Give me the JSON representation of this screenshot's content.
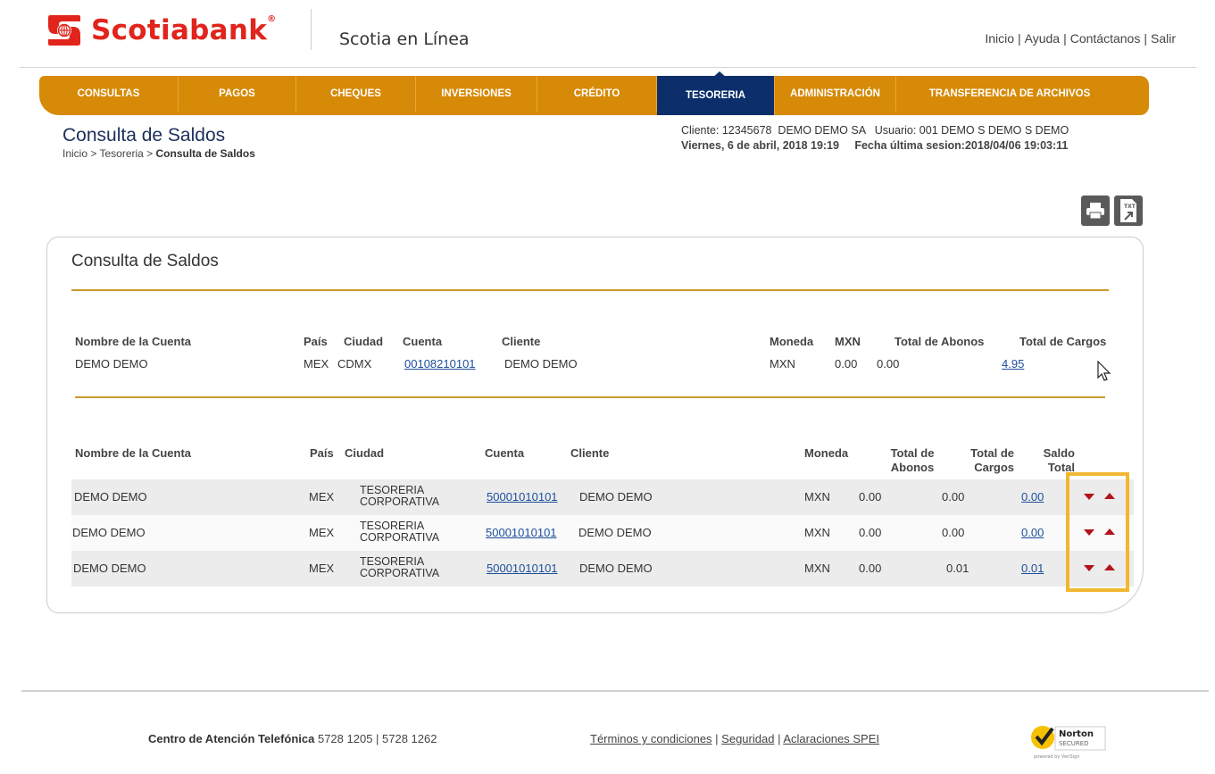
{
  "header": {
    "brand": "Scotiabank",
    "brand_reg": "®",
    "app_name": "Scotia en Línea",
    "links": [
      "Inicio",
      "Ayuda",
      "Contáctanos",
      "Salir"
    ]
  },
  "nav": {
    "items": [
      {
        "label": "CONSULTAS",
        "active": false
      },
      {
        "label": "PAGOS",
        "active": false
      },
      {
        "label": "CHEQUES",
        "active": false
      },
      {
        "label": "INVERSIONES",
        "active": false
      },
      {
        "label": "CRÉDITO",
        "active": false
      },
      {
        "label": "TESORERIA",
        "active": true
      },
      {
        "label": "ADMINISTRACIÓN",
        "active": false
      },
      {
        "label": "TRANSFERENCIA DE ARCHIVOS",
        "active": false
      }
    ]
  },
  "page": {
    "title": "Consulta de Saldos",
    "breadcrumb_prefix": "Inicio > Tesoreria > ",
    "breadcrumb_current": "Consulta de Saldos"
  },
  "client": {
    "line1": "Cliente: 12345678  DEMO DEMO SA   Usuario: 001 DEMO S DEMO S DEMO",
    "line2": "Viernes, 6 de abril, 2018 19:19     Fecha última sesion:2018/04/06 19:03:11"
  },
  "tools": {
    "print_icon": "printer-icon",
    "export_icon": "txt-export-icon",
    "export_label": "TXT"
  },
  "panel": {
    "title": "Consulta de Saldos",
    "summary_headers": {
      "name": "Nombre de la Cuenta",
      "country": "País",
      "city": "Ciudad",
      "account": "Cuenta",
      "client": "Cliente",
      "currency": "Moneda",
      "mxn": "MXN",
      "credits": "Total de Abonos",
      "debits": "Total de Cargos"
    },
    "summary_row": {
      "name": "DEMO DEMO",
      "country": "MEX",
      "city": "CDMX",
      "account": "00108210101",
      "client": "DEMO DEMO",
      "currency": "MXN",
      "mxn": "0.00",
      "credits": "0.00",
      "debits": "4.95"
    },
    "detail_headers": {
      "name": "Nombre de la Cuenta",
      "country": "País",
      "city": "Ciudad",
      "account": "Cuenta",
      "client": "Cliente",
      "currency": "Moneda",
      "credits_1": "Total de",
      "credits_2": "Abonos",
      "debits_1": "Total de",
      "debits_2": "Cargos",
      "balance_1": "Saldo",
      "balance_2": "Total"
    },
    "detail_rows": [
      {
        "name": "DEMO DEMO",
        "country": "MEX",
        "city_1": "TESORERIA",
        "city_2": "CORPORATIVA",
        "account": "50001010101",
        "client": "DEMO DEMO",
        "currency": "MXN",
        "credits": "0.00",
        "debits": "0.00",
        "balance": "0.00"
      },
      {
        "name": "DEMO DEMO",
        "country": "MEX",
        "city_1": "TESORERIA",
        "city_2": "CORPORATIVA",
        "account": "50001010101",
        "client": "DEMO DEMO",
        "currency": "MXN",
        "credits": "0.00",
        "debits": "0.00",
        "balance": "0.00"
      },
      {
        "name": "DEMO DEMO",
        "country": "MEX",
        "city_1": "TESORERIA",
        "city_2": "CORPORATIVA",
        "account": "50001010101",
        "client": "DEMO DEMO",
        "currency": "MXN",
        "credits": "0.00",
        "debits": "0.01",
        "balance": "0.01"
      }
    ]
  },
  "footer": {
    "phone_label": "Centro de Atención Telefónica",
    "phone_numbers": " 5728 1205 | 5728 1262",
    "links": [
      "Términos y condiciones",
      "Seguridad",
      "Aclaraciones SPEI"
    ],
    "norton_label": "Norton",
    "norton_secured": "SECURED",
    "norton_powered": "powered by VeriSign"
  },
  "colors": {
    "brand_red": "#e1241c",
    "nav_orange": "#d68a07",
    "nav_active": "#0c2f6b",
    "gold_rule": "#c99a2e",
    "highlight": "#f2b731",
    "sort_arrow": "#b3131b"
  }
}
